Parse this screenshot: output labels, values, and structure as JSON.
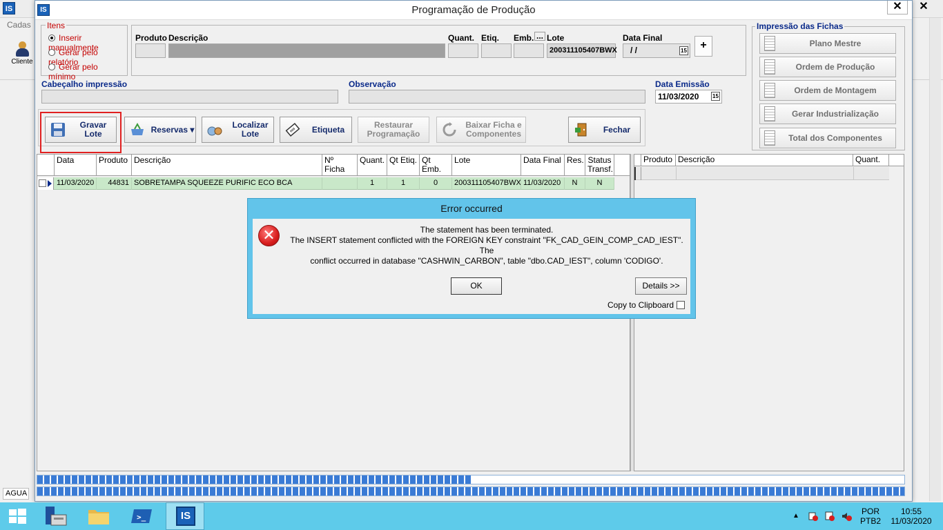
{
  "background": {
    "app_logo": "IS",
    "menu_label": "Cadas",
    "toolbar_item": "Cliente",
    "status_text": "AGUA",
    "close_glyph": "✕"
  },
  "window": {
    "logo": "IS",
    "title": "Programação de Produção",
    "close_glyph": "✕"
  },
  "itens_group": {
    "legend": "Itens",
    "options": [
      {
        "label": "Inserir manualmente",
        "selected": true
      },
      {
        "label": "Gerar pelo relatório",
        "selected": false
      },
      {
        "label": "Gerar pelo mínimo",
        "selected": false
      }
    ]
  },
  "product_fields": {
    "produto_label": "Produto",
    "descricao_label": "Descrição",
    "quant_label": "Quant.",
    "etiq_label": "Etiq.",
    "emb_label": "Emb.",
    "emb_btn": "...",
    "lote_label": "Lote",
    "lote_value": "200311105407BWX",
    "data_final_label": "Data Final",
    "data_final_value": "/ /",
    "calendar_glyph": "15",
    "plus_label": "+"
  },
  "header_fields": {
    "cabecalho_label": "Cabeçalho impressão",
    "observacao_label": "Observação",
    "data_emissao_label": "Data Emissão",
    "data_emissao_value": "11/03/2020"
  },
  "actions": {
    "gravar": "Gravar Lote",
    "reservas": "Reservas",
    "localizar_1": "Localizar",
    "localizar_2": "Lote",
    "etiqueta": "Etiqueta",
    "restaurar_1": "Restaurar",
    "restaurar_2": "Programação",
    "baixar_1": "Baixar Ficha e",
    "baixar_2": "Componentes",
    "fechar": "Fechar"
  },
  "print_group": {
    "legend": "Impressão das Fichas",
    "buttons": [
      "Plano Mestre",
      "Ordem de Produção",
      "Ordem de Montagem",
      "Gerar Industrialização",
      "Total dos Componentes"
    ]
  },
  "main_grid": {
    "headers": {
      "data": "Data",
      "produto": "Produto",
      "descricao": "Descrição",
      "nficha": "Nº Ficha",
      "quant": "Quant.",
      "qtetiq": "Qt Etiq.",
      "qtemb": "Qt Emb.",
      "lote": "Lote",
      "datafinal": "Data Final",
      "res": "Res.",
      "status": "Status Transf."
    },
    "rows": [
      {
        "data": "11/03/2020",
        "produto": "44831",
        "descricao": "SOBRETAMPA SQUEEZE PURIFIC ECO BCA",
        "nficha": "",
        "quant": "1",
        "qtetiq": "1",
        "qtemb": "0",
        "lote": "200311105407BWX",
        "datafinal": "11/03/2020",
        "res": "N",
        "status": "N"
      }
    ]
  },
  "side_grid": {
    "headers": {
      "produto": "Produto",
      "descricao": "Descrição",
      "quant": "Quant."
    }
  },
  "progress": {
    "bar1_fraction": 0.5,
    "bar2_fraction": 1.0
  },
  "dialog": {
    "title": "Error occurred",
    "icon_glyph": "✕",
    "line1": "The statement has been terminated.",
    "line2": "The INSERT statement conflicted with the FOREIGN KEY constraint \"FK_CAD_GEIN_COMP_CAD_IEST\". The",
    "line3": "conflict occurred in database \"CASHWIN_CARBON\", table \"dbo.CAD_IEST\", column 'CODIGO'.",
    "ok": "OK",
    "details": "Details >>",
    "copy": "Copy to Clipboard"
  },
  "taskbar": {
    "language_1": "POR",
    "language_2": "PTB2",
    "time": "10:55",
    "date": "11/03/2020",
    "app_label": "IS",
    "powershell_glyph": ">_"
  },
  "colors": {
    "accent": "#0a2a8a",
    "row_green": "#c9e8c9",
    "dialog_frame": "#62c4ea",
    "highlight_red": "#e02020",
    "taskbar": "#5ecbea"
  }
}
